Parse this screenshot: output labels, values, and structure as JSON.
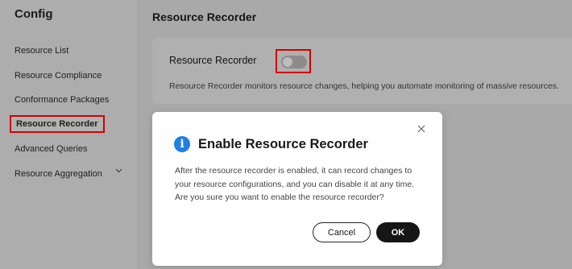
{
  "sidebar": {
    "app_title": "Config",
    "items": [
      {
        "label": "Resource List"
      },
      {
        "label": "Resource Compliance"
      },
      {
        "label": "Conformance Packages"
      },
      {
        "label": "Resource Recorder"
      },
      {
        "label": "Advanced Queries"
      },
      {
        "label": "Resource Aggregation"
      }
    ],
    "active_item": "Resource Recorder"
  },
  "main": {
    "page_title": "Resource Recorder",
    "card": {
      "label": "Resource Recorder",
      "toggle_state": "off",
      "description": "Resource Recorder monitors resource changes, helping you automate monitoring of massive resources."
    }
  },
  "dialog": {
    "icon": "info-icon",
    "title": "Enable Resource Recorder",
    "body": "After the resource recorder is enabled, it can record changes to your resource configurations, and you can disable it at any time. Are you sure you want to enable the resource recorder?",
    "cancel_label": "Cancel",
    "ok_label": "OK"
  },
  "colors": {
    "accent_blue": "#1e7fe6",
    "highlight_red": "#d40000",
    "primary_button": "#161616"
  }
}
